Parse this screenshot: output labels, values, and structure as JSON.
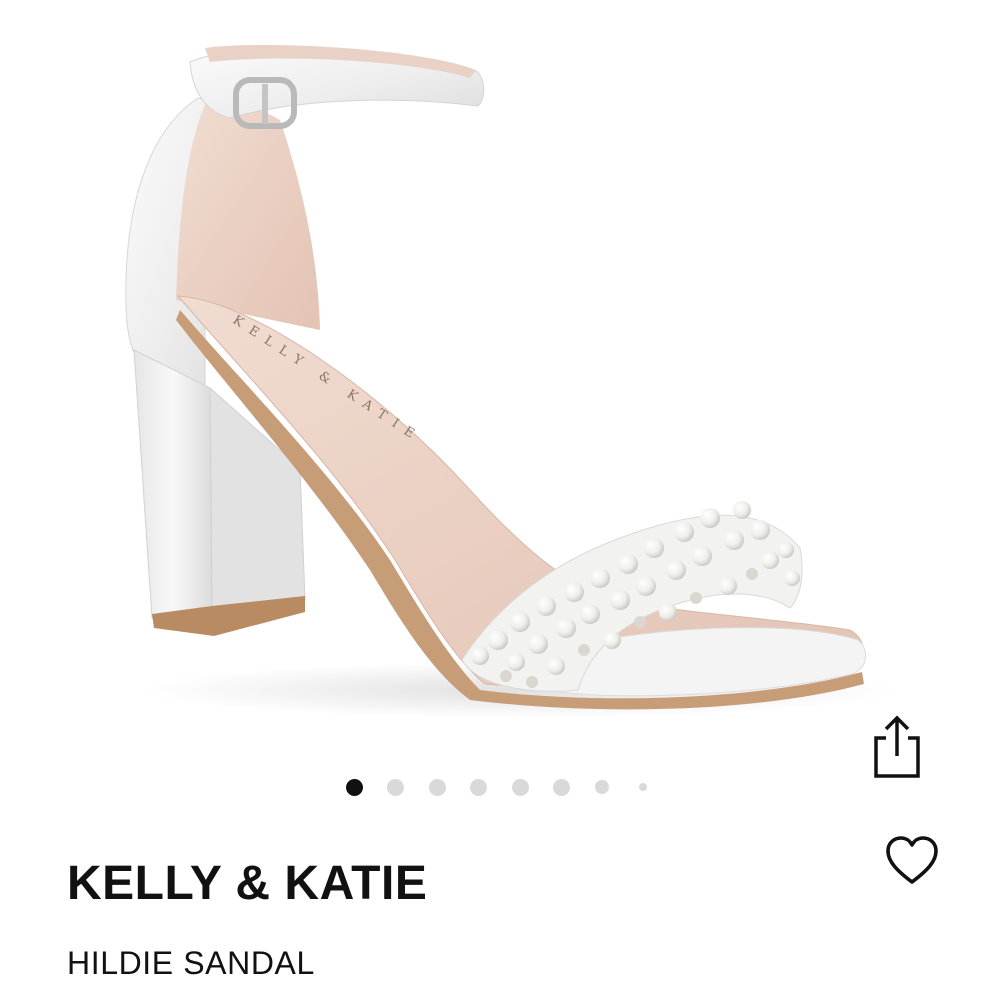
{
  "product": {
    "brand": "KELLY & KATIE",
    "name": "HILDIE SANDAL",
    "insole_print": "KELLY & KATIE",
    "image_icon": "white-satin-pearl-block-heel-sandal-image"
  },
  "carousel": {
    "total_images": 8,
    "active_index": 0,
    "active_color": "#111111",
    "inactive_color": "#d9d9d9"
  },
  "actions": {
    "share_icon": "share-icon",
    "favorite_icon": "heart-icon"
  }
}
